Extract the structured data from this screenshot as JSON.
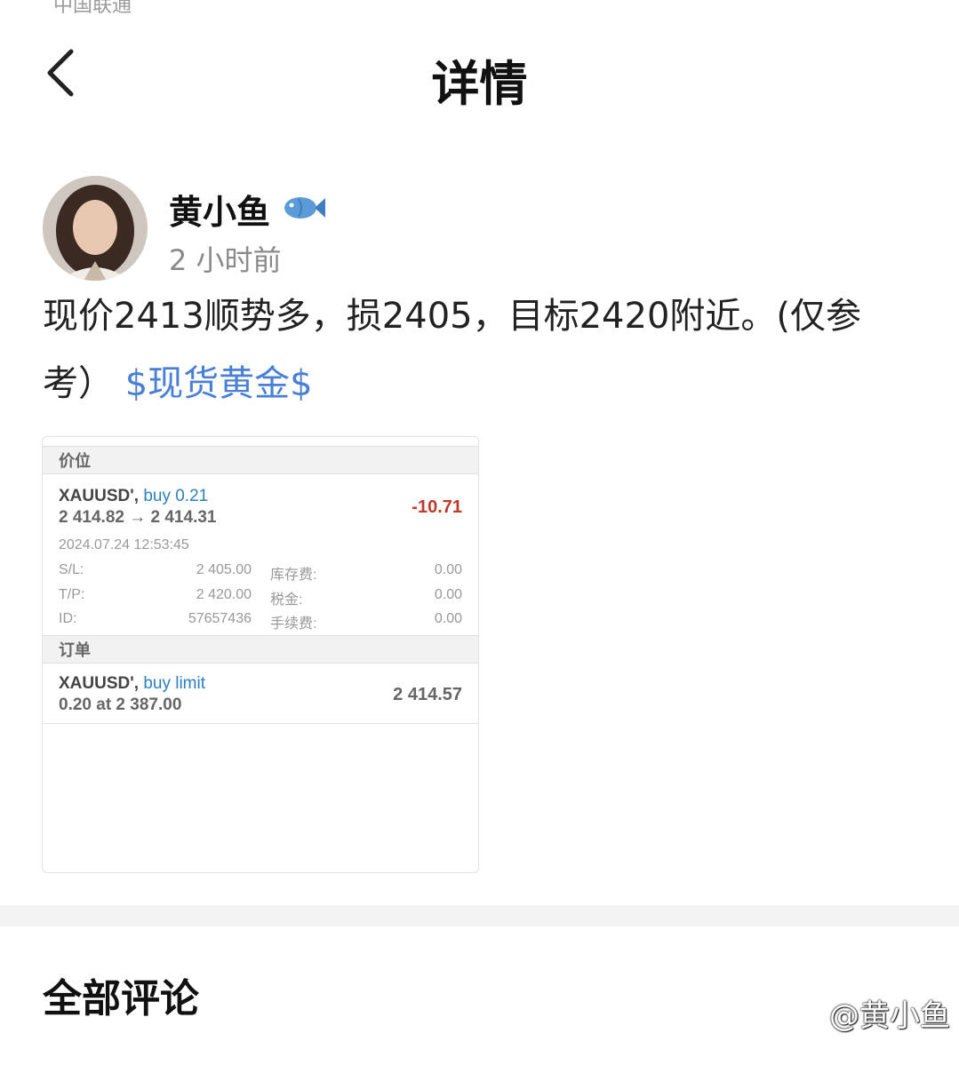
{
  "statusbar": {
    "fragment": "中国联通"
  },
  "header": {
    "title": "详情"
  },
  "post": {
    "author": "黄小鱼",
    "time": "2 小时前",
    "text": "现价2413顺势多，损2405，目标2420附近。(仅参考）",
    "topic": "$现货黄金$"
  },
  "screenshot": {
    "positions_header": "价位",
    "position": {
      "symbol": "XAUUSD',",
      "action": "buy 0.21",
      "prices": "2 414.82 → 2 414.31",
      "profit": "-10.71",
      "datetime": "2024.07.24 12:53:45",
      "sl_label": "S/L:",
      "sl_value": "2 405.00",
      "tp_label": "T/P:",
      "tp_value": "2 420.00",
      "id_label": "ID:",
      "id_value": "57657436",
      "swap_label": "库存费:",
      "swap_value": "0.00",
      "tax_label": "税金:",
      "tax_value": "0.00",
      "fee_label": "手续费:",
      "fee_value": "0.00"
    },
    "orders_header": "订单",
    "order": {
      "symbol": "XAUUSD',",
      "action": "buy limit",
      "detail": "0.20 at 2 387.00",
      "price": "2 414.57"
    }
  },
  "comments": {
    "title": "全部评论"
  },
  "watermark": {
    "text": "@黄小鱼"
  }
}
